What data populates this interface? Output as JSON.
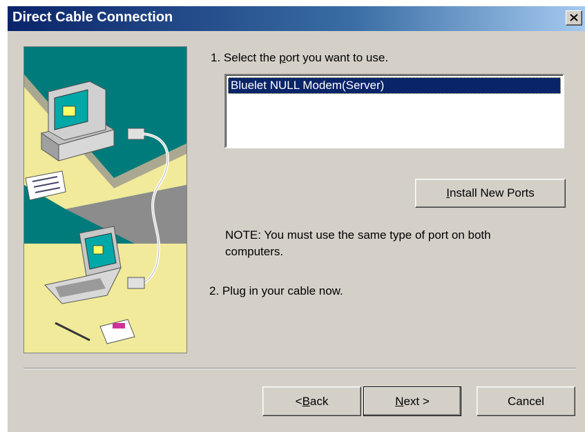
{
  "window": {
    "title": "Direct Cable Connection",
    "close_label": "close"
  },
  "step1": {
    "prefix": "1. Select the ",
    "underlined": "p",
    "suffix": "ort you want to use."
  },
  "ports": {
    "items": [
      "Bluelet NULL Modem(Server)"
    ],
    "selected_index": 0
  },
  "install_button": {
    "underlined": "I",
    "rest": "nstall New Ports"
  },
  "note": {
    "line1": "NOTE: You must use the same type of port on both",
    "line2": "computers."
  },
  "step2": {
    "text": "2. Plug in your cable now."
  },
  "footer": {
    "back": {
      "prefix": "< ",
      "underlined": "B",
      "rest": "ack"
    },
    "next": {
      "underlined": "N",
      "rest": "ext >"
    },
    "cancel": "Cancel"
  },
  "colors": {
    "titlebar_start": "#0a246a",
    "selection": "#0a246a",
    "dialog_face": "#d4d0c8",
    "illustration_teal": "#007b7b",
    "illustration_yellow": "#f0ea9a"
  }
}
